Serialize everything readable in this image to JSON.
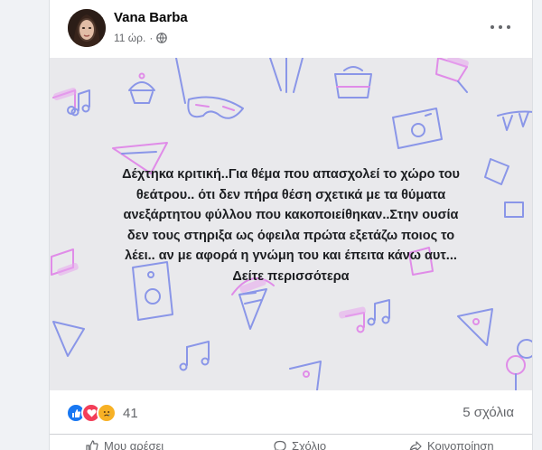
{
  "post": {
    "author": "Vana Barba",
    "time": "11 ώρ.",
    "text_lines": [
      "Δέχτηκα κριτική..Για θέμα που απασχολεί το χώρο του",
      "θεάτρου.. ότι δεν πήρα θέση σχετικά με τα θύματα",
      "ανεξάρτητου φύλλου που κακοποιείθηκαν..Στην ουσία",
      "δεν τους στηριξα ως όφειλα πρώτα εξετάζω ποιος το",
      "λέει.. αν με αφορά η γνώμη του και έπειτα κάνω αυτ..."
    ],
    "see_more": "Δείτε περισσότερα",
    "background_color": "#e9e9ec"
  },
  "footer": {
    "reaction_count": "41",
    "comments": "5 σχόλια",
    "reactions": [
      "like-icon",
      "love-icon",
      "sad-icon"
    ]
  },
  "actions": {
    "like": "Μου αρέσει",
    "comment": "Σχόλιο",
    "share": "Κοινοποίηση"
  }
}
